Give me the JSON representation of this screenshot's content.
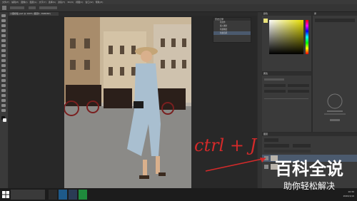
{
  "menubar": {
    "items": [
      "文件(F)",
      "编辑(E)",
      "图像(I)",
      "图层(L)",
      "文字(Y)",
      "选择(S)",
      "滤镜(T)",
      "3D(D)",
      "视图(V)",
      "窗口(W)",
      "帮助(H)"
    ]
  },
  "document": {
    "tab_label": "小图模板.psd @ 100% (图层1, RGB/8#)"
  },
  "history_panel": {
    "title": "历史记录",
    "items": [
      "新文件",
      "载入图片",
      "新建图层",
      "新建选区"
    ]
  },
  "color_panel": {
    "title": "颜色"
  },
  "adjust_panel": {
    "title": "属性"
  },
  "library_panel": {
    "title": "库"
  },
  "layers_panel": {
    "title": "图层"
  },
  "annotation": {
    "text": "ctrl + J"
  },
  "watermark": {
    "title": "百科全说",
    "subtitle": "助你轻松解决"
  },
  "taskbar": {
    "time": "10:30",
    "date": "2020/1/10"
  },
  "colors": {
    "accent_red": "#d42a2a",
    "bg_dark": "#2b2b2b",
    "panel": "#3a3a3a"
  }
}
